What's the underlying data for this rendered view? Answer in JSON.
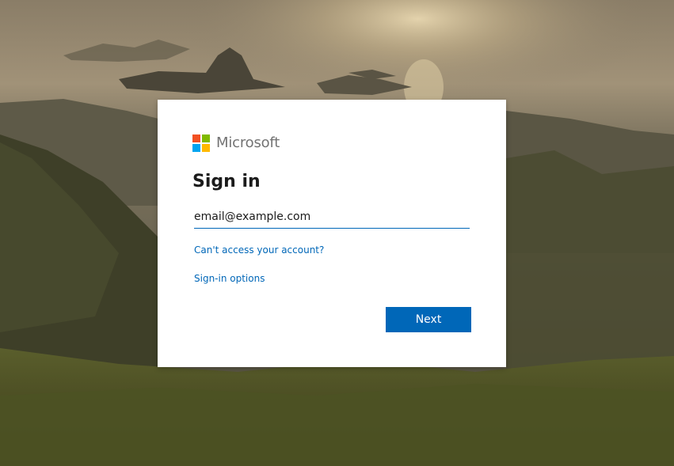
{
  "brand": {
    "name": "Microsoft",
    "logo_colors": [
      "#f25022",
      "#7fba00",
      "#00a4ef",
      "#ffb900"
    ],
    "logo_icon": "microsoft-logo-icon"
  },
  "signin": {
    "title": "Sign in",
    "email_value": "email@example.com",
    "cant_access_link": "Can't access your account?",
    "options_link": "Sign-in options",
    "next_button": "Next"
  },
  "colors": {
    "accent": "#0067b8",
    "card_background": "#ffffff",
    "title_text": "#1b1b1b"
  }
}
